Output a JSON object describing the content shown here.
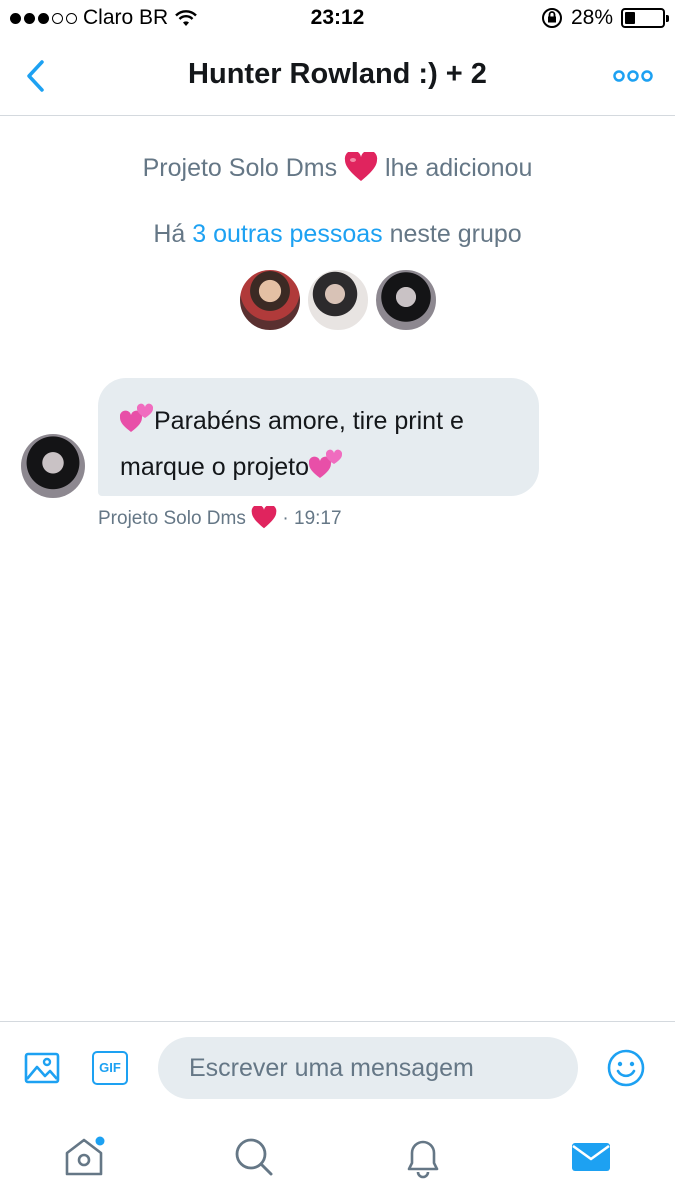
{
  "status_bar": {
    "carrier": "Claro BR",
    "time": "23:12",
    "battery": "28%",
    "battery_level": 0.28
  },
  "header": {
    "title": "Hunter Rowland :) + 2",
    "back_icon": "chevron-left-icon",
    "more_icon": "more-options-icon"
  },
  "conversation": {
    "added_by_name": "Projeto Solo Dms",
    "added_suffix": "lhe adicionou",
    "others_prefix": "Há",
    "others_link": "3 outras pessoas",
    "others_suffix": "neste grupo",
    "message": {
      "line1": "Parabéns amore, tire print e",
      "line2": "marque o projeto",
      "sender": "Projeto Solo Dms",
      "time": "· 19:17"
    }
  },
  "composer": {
    "placeholder": "Escrever uma mensagem",
    "gif_label": "GIF"
  },
  "tabs": [
    "home-icon",
    "search-icon",
    "notifications-icon",
    "messages-icon"
  ],
  "colors": {
    "accent": "#1da1f2",
    "secondary_text": "#657786",
    "bubble": "#e6ecf0",
    "heart": "#e0245e"
  }
}
